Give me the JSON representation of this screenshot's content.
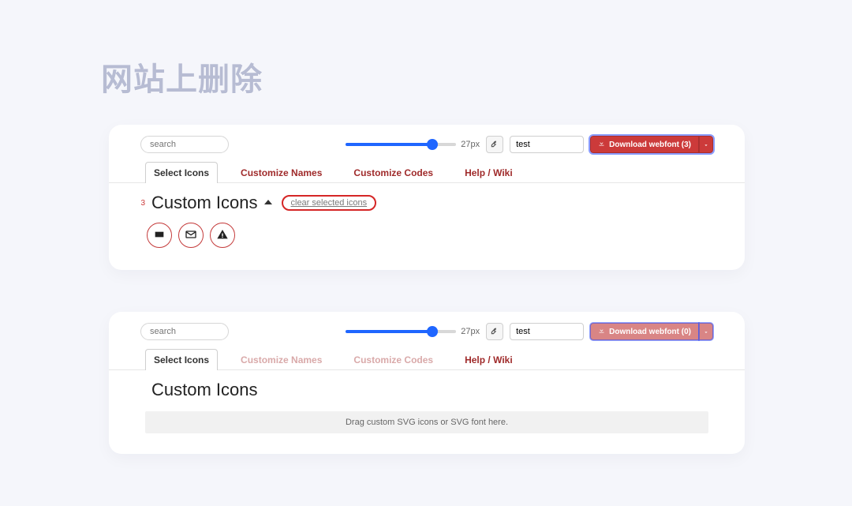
{
  "page_title": "网站上删除",
  "section1": {
    "search_placeholder": "search",
    "slider_value": "27px",
    "text_value": "test",
    "download_label": "Download webfont (3)",
    "tabs": {
      "t0": "Select Icons",
      "t1": "Customize Names",
      "t2": "Customize Codes",
      "t3": "Help / Wiki"
    },
    "count": "3",
    "section_title": "Custom Icons",
    "clear_label": "clear selected icons"
  },
  "section2": {
    "search_placeholder": "search",
    "slider_value": "27px",
    "text_value": "test",
    "download_label": "Download webfont (0)",
    "tabs": {
      "t0": "Select Icons",
      "t1": "Customize Names",
      "t2": "Customize Codes",
      "t3": "Help / Wiki"
    },
    "section_title": "Custom Icons",
    "dropzone": "Drag custom SVG icons or SVG font here."
  }
}
